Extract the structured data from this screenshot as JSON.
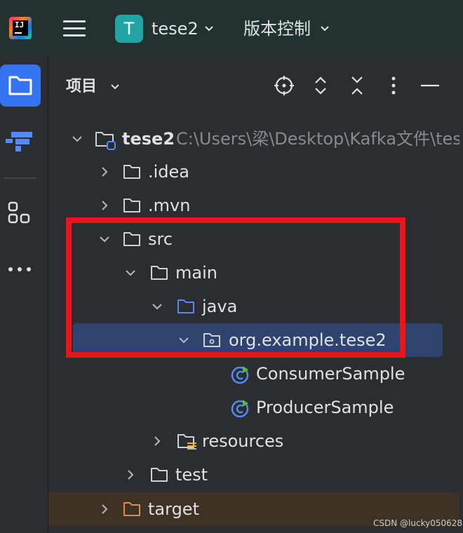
{
  "header": {
    "logo_text": "IJ",
    "project_badge": "T",
    "project_name": "tese2",
    "vcs_label": "版本控制"
  },
  "leftbar": {
    "items": [
      {
        "icon": "folder-icon",
        "active": true
      },
      {
        "icon": "structure-icon",
        "active": false
      },
      {
        "icon": "plugins-grid-icon",
        "active": false
      },
      {
        "icon": "more-dots-icon",
        "active": false
      }
    ]
  },
  "panel": {
    "title": "项目",
    "tools": [
      "locate-icon",
      "expand-all-icon",
      "collapse-all-icon",
      "more-options-icon",
      "minimize-icon"
    ]
  },
  "tree": [
    {
      "label": "tese2",
      "path": "C:\\Users\\梁\\Desktop\\Kafka文件\\tese",
      "expanded": true,
      "type": "module-folder"
    },
    {
      "label": ".idea",
      "expanded": false,
      "type": "folder"
    },
    {
      "label": ".mvn",
      "expanded": false,
      "type": "folder"
    },
    {
      "label": "src",
      "expanded": true,
      "type": "folder"
    },
    {
      "label": "main",
      "expanded": true,
      "type": "folder"
    },
    {
      "label": "java",
      "expanded": true,
      "type": "source-folder"
    },
    {
      "label": "org.example.tese2",
      "expanded": true,
      "type": "package",
      "selected": true
    },
    {
      "label": "ConsumerSample",
      "type": "java-class"
    },
    {
      "label": "ProducerSample",
      "type": "java-class"
    },
    {
      "label": "resources",
      "expanded": false,
      "type": "resources-folder"
    },
    {
      "label": "test",
      "expanded": false,
      "type": "folder"
    },
    {
      "label": "target",
      "expanded": false,
      "type": "excluded-folder"
    }
  ],
  "watermark": "CSDN @lucky050628",
  "colors": {
    "background": "#2b2d30",
    "header_bg": "#22332f",
    "accent": "#3574f0",
    "selection": "#2e436e",
    "highlight_box": "#e8161b",
    "excluded_row": "#3d3223",
    "source_folder": "#548af7",
    "excluded_folder": "#e08855"
  }
}
